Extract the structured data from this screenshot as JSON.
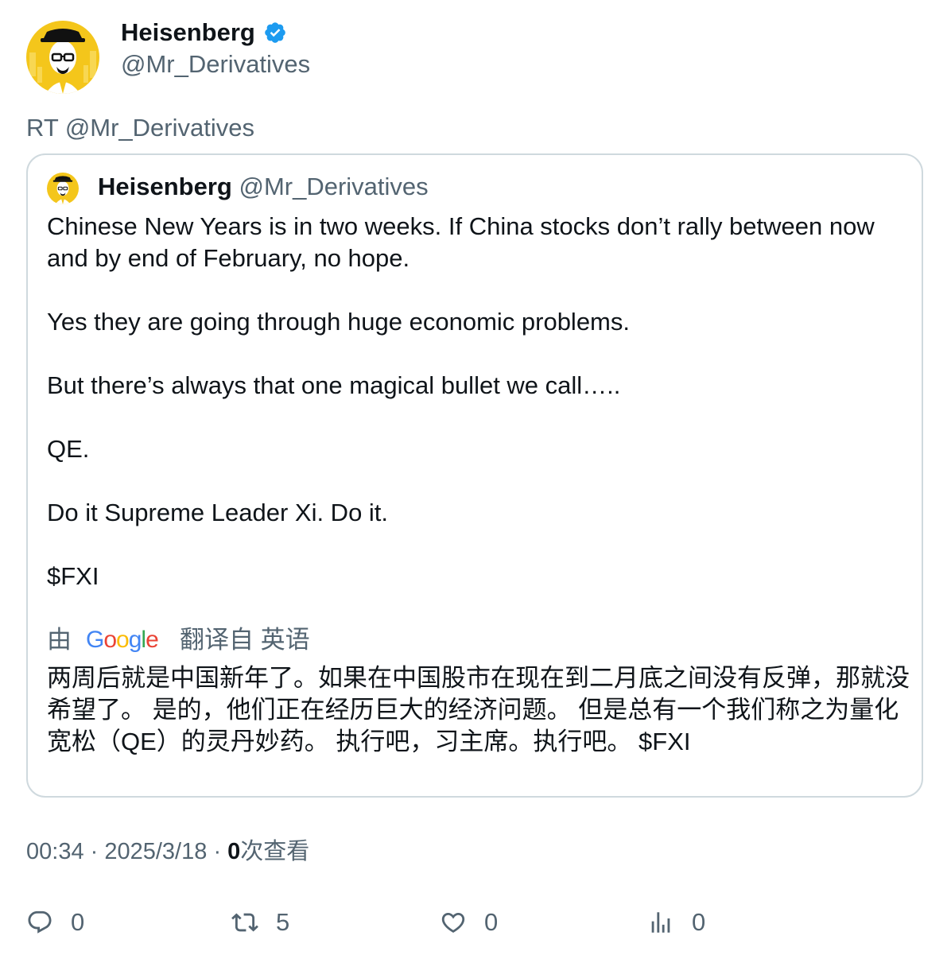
{
  "author": {
    "display_name": "Heisenberg",
    "handle": "@Mr_Derivatives",
    "verified": true,
    "avatar_icon": "heisenberg-avatar-icon"
  },
  "retweet_line": "RT @Mr_Derivatives",
  "quoted": {
    "display_name": "Heisenberg",
    "handle": "@Mr_Derivatives",
    "paragraphs": [
      "Chinese New Years is in two weeks. If China stocks don’t rally between now and by end of February, no hope.",
      "Yes they are going through huge economic problems.",
      "But there’s always that one magical bullet we call…..",
      "QE.",
      "Do it Supreme Leader Xi. Do it.",
      "$FXI"
    ],
    "translation": {
      "prefix": "由",
      "provider": "Google",
      "suffix": "翻译自 英语",
      "text": "两周后就是中国新年了。如果在中国股市在现在到二月底之间没有反弹，那就没希望了。 是的，他们正在经历巨大的经济问题。 但是总有一个我们称之为量化宽松（QE）的灵丹妙药。 执行吧，习主席。执行吧。 $FXI"
    }
  },
  "meta": {
    "time": "00:34",
    "date": "2025/3/18",
    "views_count": "0",
    "views_label": "次查看"
  },
  "actions": {
    "reply_count": "0",
    "retweet_count": "5",
    "like_count": "0",
    "views_count": "0"
  },
  "colors": {
    "text_primary": "#0f1419",
    "text_secondary": "#536471",
    "border": "#cfd9de",
    "verified_blue": "#1d9bf0",
    "avatar_yellow": "#f4c61b"
  }
}
